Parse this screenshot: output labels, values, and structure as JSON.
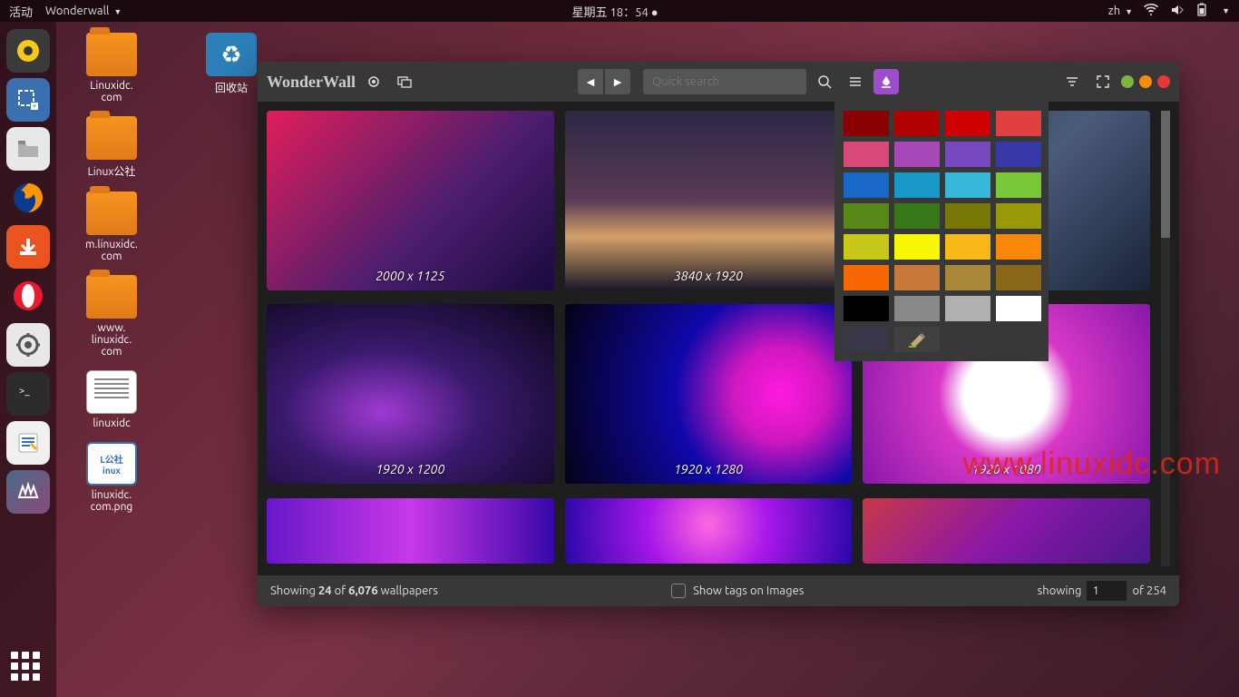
{
  "topbar": {
    "activities": "活动",
    "app_name": "Wonderwall",
    "datetime": "星期五 18：54",
    "lang": "zh"
  },
  "desktop": {
    "icons": [
      {
        "label": "Linuxidc.\ncom",
        "type": "folder"
      },
      {
        "label": "Linux公社",
        "type": "folder"
      },
      {
        "label": "m.linuxidc.\ncom",
        "type": "folder"
      },
      {
        "label": "www.\nlinuxidc.\ncom",
        "type": "folder"
      },
      {
        "label": "linuxidc",
        "type": "doc"
      },
      {
        "label": "linuxidc.\ncom.png",
        "type": "img"
      }
    ],
    "trash": "回收站"
  },
  "app": {
    "logo": "WonderWall",
    "search_placeholder": "Quick search",
    "thumbs": [
      {
        "res": "2000 x 1125",
        "bg": "linear-gradient(135deg,#e01e5a 0%,#4a1e6e 60%,#1a0a3e 100%)"
      },
      {
        "res": "3840 x 1920",
        "bg": "linear-gradient(180deg,#2a2845 0%,#5a3a55 50%,#d4a068 70%,#1a1828 100%)"
      },
      {
        "res": "",
        "bg": "linear-gradient(135deg,#2a3858 0%,#4a5a7a 50%,#1a2438 100%)"
      },
      {
        "res": "1920 x 1200",
        "bg": "radial-gradient(ellipse at 40% 60%,#a03ad4 0%,#3a1a6e 40%,#0a0618 100%)"
      },
      {
        "res": "1920 x 1280",
        "bg": "radial-gradient(circle at 75% 50%,#ff1ae0 0%,#d018c0 20%,#1008aa 45%,#040218 100%)"
      },
      {
        "res": "1920 x 1080",
        "bg": "radial-gradient(circle at 50% 50%,#fff 0%,#fff 25%,#d838c8 40%,#8818a8 100%)"
      },
      {
        "res": "",
        "bg": "linear-gradient(90deg,#6818c8 0%,#c838e8 50%,#3808a8 100%)"
      },
      {
        "res": "",
        "bg": "radial-gradient(circle at 50% 40%,#ff68e0 0%,#a818e8 40%,#2808a8 100%)"
      },
      {
        "res": "",
        "bg": "linear-gradient(135deg,#c83848 0%,#8818a8 50%,#481888 100%)"
      }
    ],
    "colors": [
      "#8a0000",
      "#b00000",
      "#d00000",
      "#e04040",
      "#d84878",
      "#a848b8",
      "#7848c0",
      "#3838a8",
      "#1868c8",
      "#1898c8",
      "#38b8d8",
      "#78c838",
      "#588818",
      "#387818",
      "#787808",
      "#989808",
      "#c8c818",
      "#f8f800",
      "#f8b818",
      "#f88808",
      "#f86800",
      "#c87838",
      "#a88838",
      "#886818",
      "#000000",
      "#888888",
      "#b0b0b0",
      "#ffffff",
      "#383848"
    ],
    "footer": {
      "showing_1": "Showing ",
      "count": "24",
      "of": " of  ",
      "total": "6,076",
      "wallpapers": " wallpapers",
      "show_tags": "Show tags on Images",
      "showing_label": "showing",
      "page": "1",
      "of_pages": "of 254"
    }
  },
  "watermark": "www.linuxidc.com"
}
